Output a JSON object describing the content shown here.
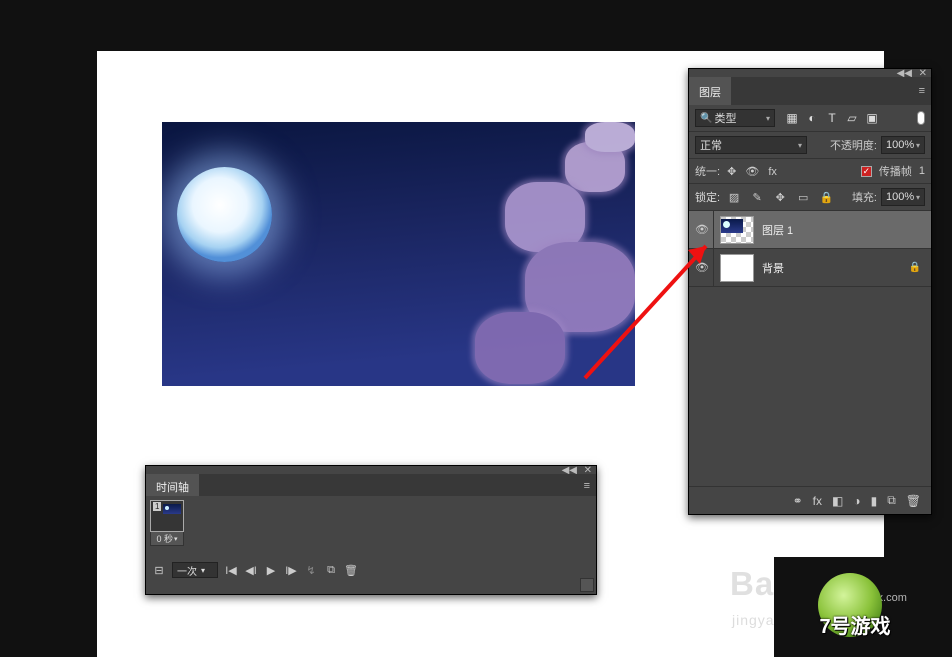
{
  "layers_panel": {
    "tab": "图层",
    "filter_type": "类型",
    "filter_icons": {
      "image": "▦",
      "adjust": "◐",
      "text": "T",
      "shape": "▱",
      "smart": "▣"
    },
    "blend_mode": "正常",
    "opacity_label": "不透明度:",
    "opacity_value": "100%",
    "unify_label": "统一:",
    "propagate_label": "传播帧",
    "propagate_index": "1",
    "lock_label": "锁定:",
    "fill_label": "填充:",
    "fill_value": "100%",
    "items": [
      {
        "name": "图层 1",
        "locked": false
      },
      {
        "name": "背景",
        "locked": true
      }
    ],
    "footer": {
      "link": "⚭",
      "fx": "fx",
      "mask": "◧",
      "adjust": "◑",
      "group": "▮",
      "new": "⧉",
      "delete": "🗑"
    }
  },
  "timeline_panel": {
    "tab": "时间轴",
    "frame": {
      "num": "1",
      "duration": "0 秒"
    },
    "loop_mode": "一次",
    "controls": {
      "first": "I◀",
      "prev": "◀I",
      "play": "▶",
      "next": "I▶",
      "tween": "↯",
      "dup": "⧉",
      "delete": "🗑"
    }
  },
  "branding": {
    "logo1": "Baidu",
    "logo1_sub": "jingyan",
    "url": "xiayx.com",
    "game_text": "7号游戏"
  },
  "glyphs": {
    "collapse": "◀◀",
    "close": "✕",
    "menu": "≡",
    "search": "🔍",
    "chevron_down": "▾",
    "eye": "👁",
    "lock": "🔒",
    "checkmark": "✓",
    "lock_pixel": "▨",
    "lock_brush": "✎",
    "lock_move": "✥",
    "lock_artboard": "▭",
    "lock_all": "🔒",
    "unify_pos": "✥",
    "unify_vis": "👁",
    "unify_style": "fx",
    "toggle": "⊟"
  }
}
